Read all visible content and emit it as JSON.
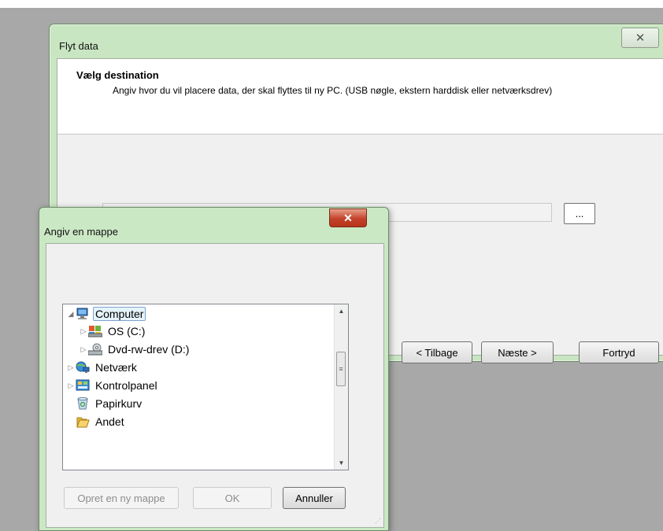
{
  "wizard": {
    "title": "Flyt data",
    "close_glyph": "✕",
    "header_title": "Vælg destination",
    "header_subtitle": "Angiv hvor du vil placere data, der skal flyttes til ny PC. (USB nøgle, ekstern harddisk eller netværksdrev)",
    "path_value": "",
    "browse_label": "...",
    "back_label": "< Tilbage",
    "next_label": "Næste >",
    "cancel_label": "Fortryd"
  },
  "dialog": {
    "title": "Angiv en mappe",
    "close_glyph": "✕",
    "tree": [
      {
        "label": "Computer",
        "icon": "computer-icon",
        "expander": "expanded",
        "selected": true
      },
      {
        "label": "OS (C:)",
        "icon": "drive-icon",
        "expander": "collapsed",
        "selected": false
      },
      {
        "label": "Dvd-rw-drev (D:)",
        "icon": "dvd-drive-icon",
        "expander": "collapsed",
        "selected": false
      },
      {
        "label": "Netværk",
        "icon": "network-icon",
        "expander": "collapsed",
        "selected": false
      },
      {
        "label": "Kontrolpanel",
        "icon": "control-panel-icon",
        "expander": "collapsed",
        "selected": false
      },
      {
        "label": "Papirkurv",
        "icon": "recycle-bin-icon",
        "expander": "none",
        "selected": false
      },
      {
        "label": "Andet",
        "icon": "folder-icon",
        "expander": "none",
        "selected": false
      }
    ],
    "new_folder_label": "Opret en ny mappe",
    "ok_label": "OK",
    "cancel_label": "Annuller"
  }
}
